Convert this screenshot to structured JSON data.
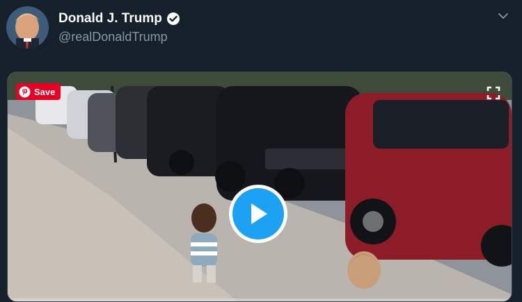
{
  "tweet": {
    "display_name": "Donald J. Trump",
    "handle": "@realDonaldTrump",
    "verified": true
  },
  "media": {
    "save_label": "Save",
    "progress": 0.0
  },
  "colors": {
    "background": "#15202b",
    "accent": "#1da1f2",
    "pinterest": "#e60023",
    "secondary_text": "#8899a6"
  },
  "icons": [
    "verified-badge-icon",
    "chevron-down-icon",
    "pinterest-icon",
    "fullscreen-icon",
    "play-icon"
  ]
}
